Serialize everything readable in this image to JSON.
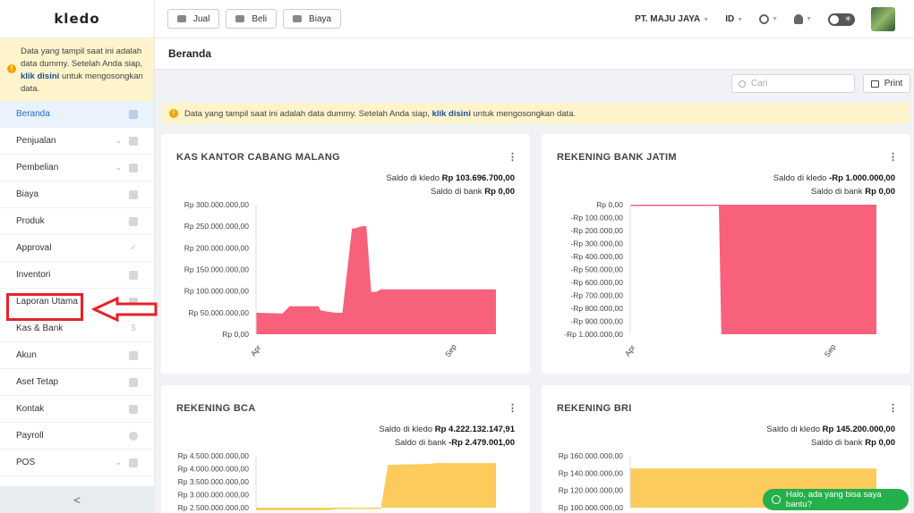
{
  "sidebar": {
    "logo": "kledo",
    "notice": {
      "text_before": "Data yang tampil saat ini adalah data dummy. Setelah Anda siap,",
      "link": "klik disini",
      "text_after": "untuk mengosongkan data."
    },
    "items": [
      {
        "label": "Beranda",
        "icon": "home-icon",
        "active": true
      },
      {
        "label": "Penjualan",
        "icon": "basket-icon",
        "chevron": true
      },
      {
        "label": "Pembelian",
        "icon": "bag-icon",
        "chevron": true
      },
      {
        "label": "Biaya",
        "icon": "card-icon"
      },
      {
        "label": "Produk",
        "icon": "box-icon"
      },
      {
        "label": "Approval",
        "icon": "check-icon"
      },
      {
        "label": "Inventori",
        "icon": "warehouse-icon"
      },
      {
        "label": "Laporan Utama",
        "icon": "report-icon"
      },
      {
        "label": "Kas & Bank",
        "icon": "dollar-icon"
      },
      {
        "label": "Akun",
        "icon": "ledger-icon"
      },
      {
        "label": "Aset Tetap",
        "icon": "building-icon"
      },
      {
        "label": "Kontak",
        "icon": "contact-icon"
      },
      {
        "label": "Payroll",
        "icon": "payroll-icon"
      },
      {
        "label": "POS",
        "icon": "pos-icon",
        "chevron": true
      }
    ],
    "collapse": "<"
  },
  "topbar": {
    "buttons": [
      {
        "label": "Jual",
        "icon": "basket-icon"
      },
      {
        "label": "Beli",
        "icon": "bag-icon"
      },
      {
        "label": "Biaya",
        "icon": "card-icon"
      }
    ],
    "company": "PT. MAJU JAYA",
    "language": "ID"
  },
  "page": {
    "title": "Beranda",
    "search_placeholder": "Cari",
    "print_label": "Print",
    "notice": {
      "text_before": "Data yang tampil saat ini adalah data dummy. Setelah Anda siap,",
      "link": "klik disini",
      "text_after": "untuk mengosongkan data."
    }
  },
  "cards": [
    {
      "title": "KAS KANTOR CABANG MALANG",
      "saldo_kledo_label": "Saldo di kledo",
      "saldo_kledo": "Rp 103.696.700,00",
      "saldo_bank_label": "Saldo di bank",
      "saldo_bank": "Rp 0,00"
    },
    {
      "title": "REKENING BANK JATIM",
      "saldo_kledo_label": "Saldo di kledo",
      "saldo_kledo": "-Rp 1.000.000,00",
      "saldo_bank_label": "Saldo di bank",
      "saldo_bank": "Rp 0,00"
    },
    {
      "title": "REKENING BCA",
      "saldo_kledo_label": "Saldo di kledo",
      "saldo_kledo": "Rp 4.222.132.147,91",
      "saldo_bank_label": "Saldo di bank",
      "saldo_bank": "-Rp 2.479.001,00"
    },
    {
      "title": "REKENING BRI",
      "saldo_kledo_label": "Saldo di kledo",
      "saldo_kledo": "Rp 145.200.000,00",
      "saldo_bank_label": "Saldo di bank",
      "saldo_bank": "Rp 0,00"
    }
  ],
  "chart_data": [
    {
      "type": "area",
      "color": "#f8617b",
      "x_tick_labels": [
        "Apr",
        "Sep"
      ],
      "y_tick_labels": [
        "Rp 300.000.000,00",
        "Rp 250.000.000,00",
        "Rp 200.000.000,00",
        "Rp 150.000.000,00",
        "Rp 100.000.000,00",
        "Rp 50.000.000,00",
        "Rp 0,00"
      ],
      "ylim": [
        0,
        300000000
      ],
      "x": [
        0,
        0.11,
        0.14,
        0.26,
        0.27,
        0.29,
        0.33,
        0.36,
        0.4,
        0.41,
        0.44,
        0.46,
        0.48,
        0.5,
        0.52,
        0.54,
        1.0
      ],
      "values": [
        50000000,
        48000000,
        65000000,
        65000000,
        55000000,
        53000000,
        50000000,
        50000000,
        245000000,
        245000000,
        250000000,
        250000000,
        98000000,
        98000000,
        104000000,
        104000000,
        104000000
      ]
    },
    {
      "type": "area",
      "color": "#f8617b",
      "x_tick_labels": [
        "Apr",
        "Sep"
      ],
      "y_tick_labels": [
        "Rp 0,00",
        "-Rp 100.000,00",
        "-Rp 200.000,00",
        "-Rp 300.000,00",
        "-Rp 400.000,00",
        "-Rp 500.000,00",
        "-Rp 600.000,00",
        "-Rp 700.000,00",
        "-Rp 800.000,00",
        "-Rp 900.000,00",
        "-Rp 1.000.000,00"
      ],
      "ylim": [
        -1000000,
        0
      ],
      "x": [
        0,
        0.36,
        0.37,
        1.0
      ],
      "values": [
        -10000,
        -10000,
        -1000000,
        -1000000
      ]
    },
    {
      "type": "area",
      "color": "#fdcb5c",
      "y_tick_labels": [
        "Rp 4.500.000.000,00",
        "Rp 4.000.000.000,00",
        "Rp 3.500.000.000,00",
        "Rp 3.000.000.000,00",
        "Rp 2.500.000.000,00"
      ],
      "ylim": [
        2500000000,
        4500000000
      ],
      "x": [
        0,
        0.3,
        0.35,
        0.45,
        0.52,
        0.55,
        0.7,
        0.72,
        0.75,
        1.0
      ],
      "values": [
        2400000000,
        2400000000,
        2450000000,
        2450000000,
        2450000000,
        4150000000,
        4180000000,
        4180000000,
        4220000000,
        4220000000
      ]
    },
    {
      "type": "area",
      "color": "#fdcb5c",
      "y_tick_labels": [
        "Rp 160.000.000,00",
        "Rp 140.000.000,00",
        "Rp 120.000.000,00",
        "Rp 100.000.000,00"
      ],
      "ylim": [
        100000000,
        160000000
      ],
      "x": [
        0,
        1.0
      ],
      "values": [
        145200000,
        145200000
      ]
    }
  ],
  "whatsapp": {
    "label": "Halo, ada yang bisa saya bantu?"
  }
}
